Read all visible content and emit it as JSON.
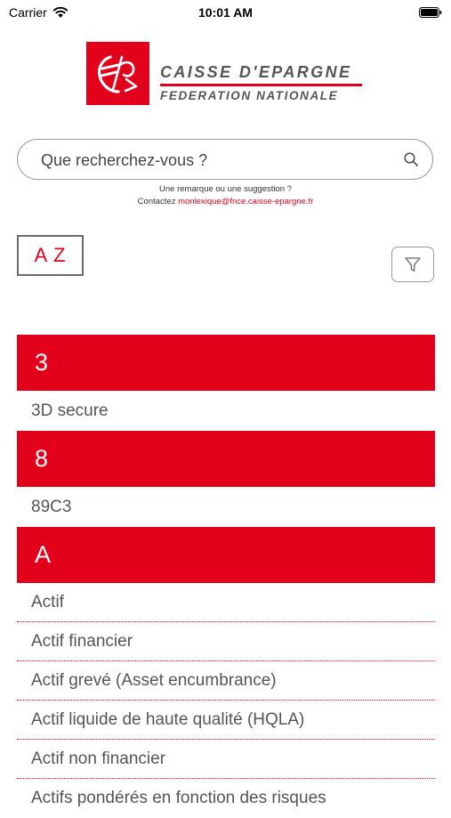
{
  "status_bar": {
    "carrier": "Carrier",
    "time": "10:01 AM"
  },
  "logo": {
    "name": "CAISSE D'EPARGNE",
    "subtitle": "FEDERATION NATIONALE",
    "brand_color": "#e2001a"
  },
  "search": {
    "placeholder": "Que recherchez-vous ?",
    "icon": "search-icon"
  },
  "feedback": {
    "remark": "Une remarque ou une suggestion ?",
    "contact_label": "Contactez",
    "email": "monlexique@fnce.caisse-epargne.fr"
  },
  "sort": {
    "label": "A Z"
  },
  "filter": {
    "icon": "filter-icon"
  },
  "list": {
    "sections": [
      {
        "letter": "3",
        "items": [
          "3D secure"
        ]
      },
      {
        "letter": "8",
        "items": [
          "89C3"
        ]
      },
      {
        "letter": "A",
        "items": [
          "Actif",
          "Actif financier",
          "Actif grevé (Asset encumbrance)",
          "Actif liquide de haute qualité (HQLA)",
          "Actif non financier",
          "Actifs pondérés en fonction des risques"
        ]
      }
    ]
  }
}
